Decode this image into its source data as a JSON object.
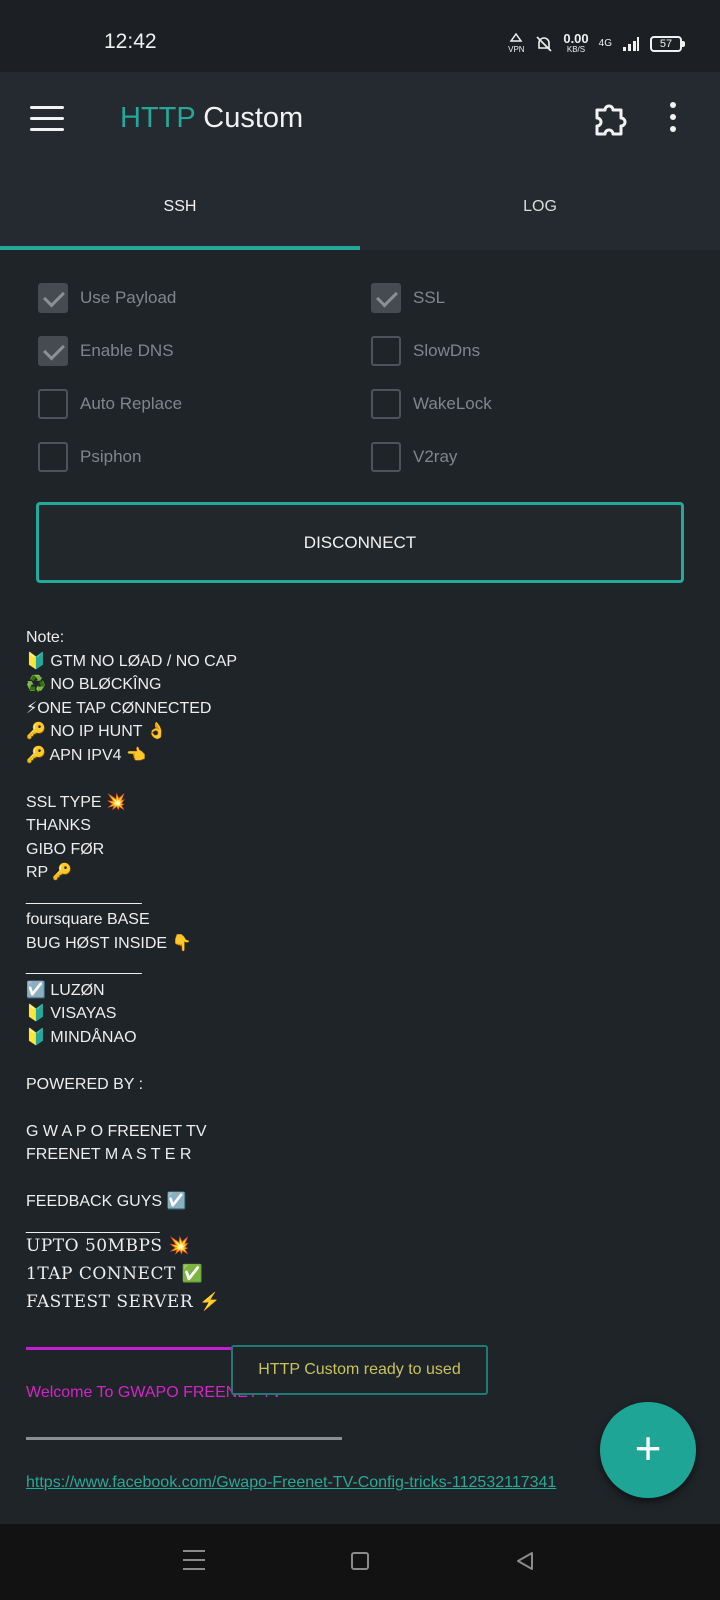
{
  "status_bar": {
    "time": "12:42",
    "vpn": "VPN",
    "speed_value": "0.00",
    "speed_unit": "KB/S",
    "network": "4G",
    "battery": "57"
  },
  "toolbar": {
    "title_part1": "HTTP",
    "title_part2": "Custom",
    "icons": [
      "menu-icon",
      "puzzle-icon",
      "more-vert-icon"
    ]
  },
  "tabs": [
    {
      "label": "SSH",
      "selected": true
    },
    {
      "label": "LOG",
      "selected": false
    }
  ],
  "options": {
    "use_payload": {
      "label": "Use Payload",
      "checked": true
    },
    "ssl": {
      "label": "SSL",
      "checked": true
    },
    "enable_dns": {
      "label": "Enable DNS",
      "checked": true
    },
    "slowdns": {
      "label": "SlowDns",
      "checked": false
    },
    "auto_replace": {
      "label": "Auto Replace",
      "checked": false
    },
    "wakelock": {
      "label": "WakeLock",
      "checked": false
    },
    "psiphon": {
      "label": "Psiphon",
      "checked": false
    },
    "v2ray": {
      "label": "V2ray",
      "checked": false
    }
  },
  "disconnect_label": "DISCONNECT",
  "note_text": "Note:\n🔰 GTM NO LØAD / NO CAP\n♻️ NO BLØCKÎNG\n⚡ONE TAP CØNNECTED\n🔑 NO IP HUNT 👌\n🔑 APN IPV4 👈\n\nSSL TYPE 💥\nTHANKS\nGIBO FØR\nRP 🔑\n_____________\nfoursquare BASE\nBUG HØST INSIDE 👇\n_____________\n☑️ LUZØN\n🔰 VISAYAS\n🔰 MINDÅNAO\n\nPOWERED BY :\n\nG W A P O FREENET TV\nFREENET M A S T E R\n\nFEEDBACK GUYS ☑️\n_______________",
  "highlights": "UPTO 50MBPS 💥\n1TAP CONNECT ✅\nFASTEST SERVER ⚡",
  "welcome_text": "Welcome To GWAPO FREENET TV",
  "facebook_link": "https://www.facebook.com/Gwapo-Freenet-TV-Config-tricks-112532117341",
  "toast": "HTTP Custom ready to used",
  "fab_label": "+",
  "colors": {
    "accent": "#25a89a",
    "background": "#1f2428",
    "toolbar": "#242a2f",
    "welcome": "#d623c9",
    "toast_text": "#c9c35a"
  }
}
